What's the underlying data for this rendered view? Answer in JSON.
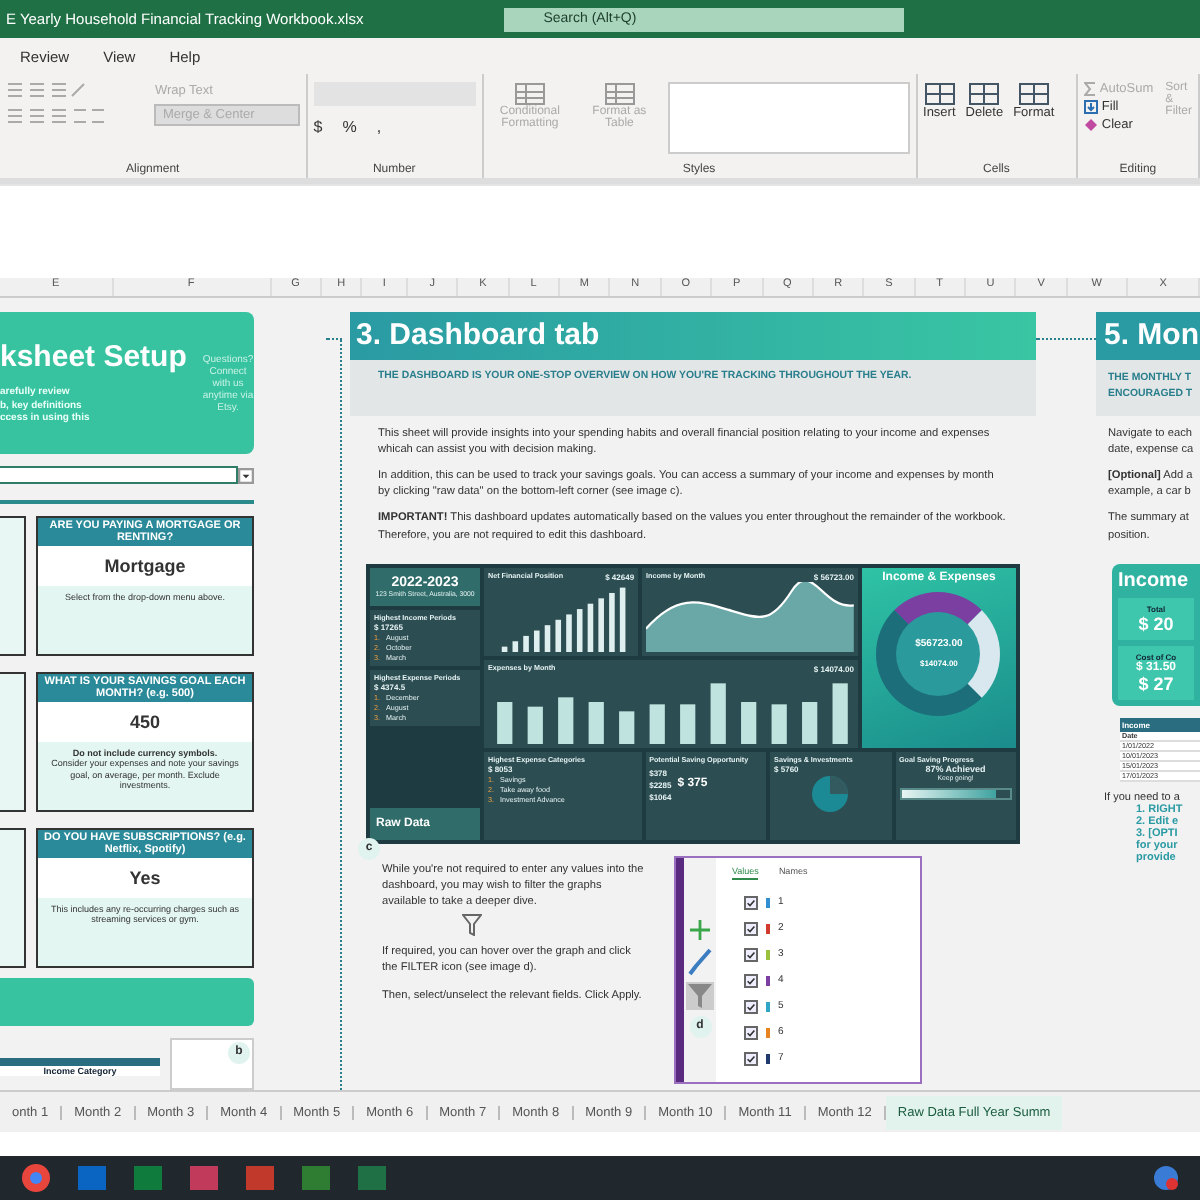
{
  "window": {
    "title": "E Yearly Household Financial Tracking Workbook.xlsx",
    "search": {
      "placeholder": "Search (Alt+Q)"
    }
  },
  "ribbon_tabs": [
    "Review",
    "View",
    "Help"
  ],
  "ribbon": {
    "alignment": {
      "wrap": "Wrap Text",
      "merge": "Merge & Center",
      "label": "Alignment"
    },
    "number": {
      "label": "Number",
      "currency": "$",
      "percent": "%",
      "comma": ","
    },
    "styles": {
      "conditional": "Conditional Formatting",
      "table": "Format as Table",
      "label": "Styles"
    },
    "cells": {
      "buttons": [
        "Insert",
        "Delete",
        "Format"
      ],
      "label": "Cells"
    },
    "editing": {
      "autosum": "AutoSum",
      "fill": "Fill",
      "clear": "Clear",
      "sort": "Sort &",
      "filter": "Filter",
      "label": "Editing"
    }
  },
  "columns": [
    "E",
    "F",
    "G",
    "H",
    "I",
    "J",
    "K",
    "L",
    "M",
    "N",
    "O",
    "P",
    "Q",
    "R",
    "S",
    "T",
    "U",
    "V",
    "W",
    "X"
  ],
  "setup": {
    "title": "ksheet Setup",
    "intro": [
      "arefully review",
      "b, key definitions",
      "ccess in using this"
    ],
    "contact": "Questions? Connect with us anytime via Etsy.",
    "cards": [
      {
        "question": "ARE YOU PAYING A MORTGAGE OR RENTING?",
        "answer": "Mortgage",
        "note": "Select from the drop-down menu above."
      },
      {
        "question": "WHAT IS YOUR SAVINGS GOAL EACH MONTH? (e.g. 500)",
        "answer": "450",
        "note_bold": "Do not include currency symbols.",
        "note": "Consider your expenses and note your savings goal, on average, per month. Exclude investments."
      },
      {
        "question": "DO YOU HAVE SUBSCRIPTIONS? (e.g. Netflix, Spotify)",
        "answer": "Yes",
        "note": "This includes any re-occurring charges such as streaming services or gym."
      }
    ],
    "table_header": "Income Category",
    "image_label": "b"
  },
  "dashboard_section": {
    "title": "3. Dashboard tab",
    "subtitle": "THE DASHBOARD IS YOUR ONE-STOP OVERVIEW ON HOW YOU'RE TRACKING THROUGHOUT THE YEAR.",
    "paragraphs": [
      "This sheet will provide insights into your spending habits and overall financial position relating to your income and expenses whicah can assist you with decision making.",
      "In addition, this can be used to track your savings goals. You can access a summary of your income and expenses by month by clicking \"raw data\" on the bottom-left corner (see image c).",
      "**IMPORTANT!** This dashboard updates automatically based on the values you enter throughout the remainder of the workbook. Therefore, you are not required to edit this dashboard."
    ],
    "dashboard": {
      "year": "2022-2023",
      "address": "123 Smith Street, Australia, 3000",
      "income_periods": {
        "title": "Highest Income Periods",
        "total": "$ 17265",
        "rows": [
          {
            "rank": "1.",
            "month": "August"
          },
          {
            "rank": "2.",
            "month": "October"
          },
          {
            "rank": "3.",
            "month": "March"
          }
        ]
      },
      "expense_periods": {
        "title": "Highest Expense Periods",
        "total": "$ 4374.5",
        "rows": [
          {
            "rank": "1.",
            "month": "December"
          },
          {
            "rank": "2.",
            "month": "August"
          },
          {
            "rank": "3.",
            "month": "March"
          }
        ]
      },
      "raw_data": "Raw Data",
      "net": {
        "title": "Net Financial Position",
        "value": "$ 42649"
      },
      "income_month": {
        "title": "Income by Month",
        "value": "$ 56723.00"
      },
      "expenses_month": {
        "title": "Expenses by Month",
        "value": "$ 14074.00"
      },
      "donut": {
        "title": "Income & Expenses",
        "income": "$56723.00",
        "expenses": "$14074.00"
      },
      "categories": {
        "title": "Highest Expense Categories",
        "total": "$ 8053",
        "rows": [
          {
            "rank": "1.",
            "name": "Savings"
          },
          {
            "rank": "2.",
            "name": "Take away food"
          },
          {
            "rank": "3.",
            "name": "Investment Advance"
          }
        ]
      },
      "saving": {
        "title": "Potential Saving Opportunity",
        "rows": [
          "$378",
          "$2285",
          "$1064"
        ],
        "big": "$ 375"
      },
      "investments": {
        "title": "Savings & Investments",
        "value": "$ 5760"
      },
      "goal": {
        "title": "Goal Saving Progress",
        "achieved": "87% Achieved",
        "note": "Keep going!",
        "level": 0.87
      }
    },
    "image_label": "c",
    "notes": [
      "While you're not required to enter any values into the dashboard, you may wish to filter the graphs available to take a deeper dive.",
      "If required, you can hover over the graph and click the FILTER icon (see image d).",
      "Then, select/unselect the relevant fields. Click Apply."
    ],
    "filter_pane": {
      "tabs": [
        {
          "label": "Values",
          "selected": true
        },
        {
          "label": "Names",
          "selected": false
        }
      ],
      "label": "d",
      "items": [
        {
          "label": "1",
          "checked": true,
          "color": "#2f8fd0"
        },
        {
          "label": "2",
          "checked": true,
          "color": "#d03a2f"
        },
        {
          "label": "3",
          "checked": true,
          "color": "#9bc13a"
        },
        {
          "label": "4",
          "checked": true,
          "color": "#7a3fa0"
        },
        {
          "label": "5",
          "checked": true,
          "color": "#2fa6c8"
        },
        {
          "label": "6",
          "checked": true,
          "color": "#e8841f"
        },
        {
          "label": "7",
          "checked": true,
          "color": "#1f3a6b"
        }
      ]
    }
  },
  "monthly_section": {
    "title": "5. Mon",
    "subtitle": [
      "THE MONTHLY T",
      "ENCOURAGED T"
    ],
    "paragraphs": [
      [
        "Navigate to each",
        "date, expense ca"
      ],
      [
        "**[Optional]** Add a",
        "example, a car b"
      ],
      [
        "The summary at",
        "position."
      ]
    ],
    "card": {
      "title": "Income",
      "total_label": "Total",
      "total": "$ 20",
      "cost_label": "Cost of Co",
      "cost": "$ 31.50",
      "big": "$ 27"
    },
    "table_header": "Income",
    "table_col": "Date",
    "dates": [
      "1/01/2022",
      "10/01/2023",
      "15/01/2023",
      "17/01/2023"
    ],
    "help": "If you need to a",
    "steps": [
      "1. RIGHT",
      "2. Edit e",
      "3. [OPTI",
      "for your",
      "provide"
    ]
  },
  "sheet_tabs": [
    {
      "label": "onth 1",
      "selected": false
    },
    {
      "label": "Month 2",
      "selected": false
    },
    {
      "label": "Month 3",
      "selected": false
    },
    {
      "label": "Month 4",
      "selected": false
    },
    {
      "label": "Month 5",
      "selected": false
    },
    {
      "label": "Month 6",
      "selected": false
    },
    {
      "label": "Month 7",
      "selected": false
    },
    {
      "label": "Month 8",
      "selected": false
    },
    {
      "label": "Month 9",
      "selected": false
    },
    {
      "label": "Month 10",
      "selected": false
    },
    {
      "label": "Month 11",
      "selected": false
    },
    {
      "label": "Month 12",
      "selected": false
    },
    {
      "label": "Raw Data Full Year Summ",
      "selected": true
    }
  ]
}
